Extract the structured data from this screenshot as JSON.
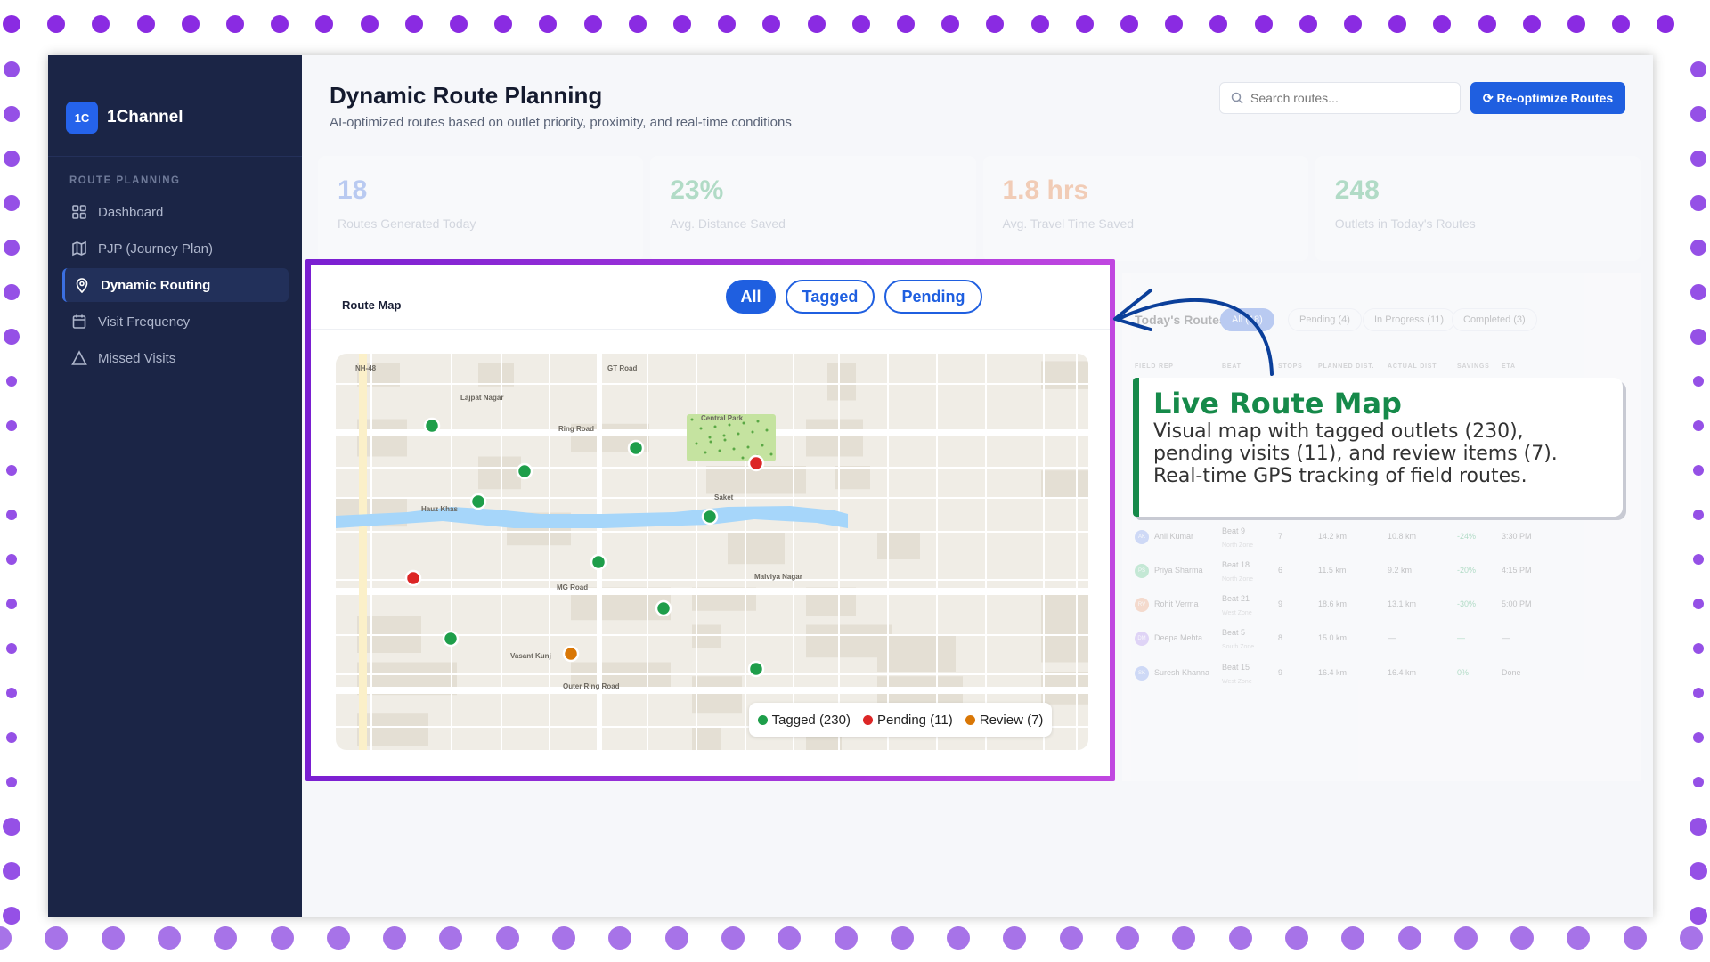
{
  "sidebar": {
    "logo": "1C",
    "brand": "1Channel",
    "section": "ROUTE PLANNING",
    "items": [
      {
        "label": "Dashboard",
        "icon": "grid-icon"
      },
      {
        "label": "PJP (Journey Plan)",
        "icon": "map-icon"
      },
      {
        "label": "Dynamic Routing",
        "icon": "location-pin-icon",
        "active": true
      },
      {
        "label": "Visit Frequency",
        "icon": "calendar-icon"
      },
      {
        "label": "Missed Visits",
        "icon": "warning-icon"
      }
    ]
  },
  "header": {
    "title": "Dynamic Route Planning",
    "subtitle": "AI-optimized routes based on outlet priority, proximity, and real-time conditions",
    "search_placeholder": "Search routes...",
    "reoptimize": "⟳ Re-optimize Routes"
  },
  "stats": [
    {
      "value": "18",
      "label": "Routes Generated Today",
      "color": "#3b6fe0"
    },
    {
      "value": "23%",
      "label": "Avg. Distance Saved",
      "color": "#22a35a"
    },
    {
      "value": "1.8 hrs",
      "label": "Avg. Travel Time Saved",
      "color": "#e8742a"
    },
    {
      "value": "248",
      "label": "Outlets in Today's Routes",
      "color": "#22a35a"
    }
  ],
  "map_card": {
    "title": "Route Map",
    "filters": [
      "All",
      "Tagged",
      "Pending"
    ],
    "active_filter": "All",
    "labels": [
      "NH-48",
      "Lajpat Nagar",
      "Ring Road",
      "GT Road",
      "Central Park",
      "Hauz Khas",
      "Saket",
      "Malviya Nagar",
      "MG Road",
      "Vasant Kunj",
      "Outer Ring Road"
    ],
    "legend": [
      {
        "label": "Tagged (230)",
        "color": "#1e9e4a"
      },
      {
        "label": "Pending (11)",
        "color": "#dc2626"
      },
      {
        "label": "Review (7)",
        "color": "#d97706"
      }
    ]
  },
  "routes": {
    "title": "Today's Routes",
    "tabs": [
      "All (18)",
      "Pending (4)",
      "In Progress (11)",
      "Completed (3)"
    ],
    "columns": [
      "FIELD REP",
      "BEAT",
      "STOPS",
      "PLANNED DIST.",
      "ACTUAL DIST.",
      "SAVINGS",
      "ETA"
    ],
    "rows": [
      {
        "initials": "SK",
        "name": "Suresh Khanna",
        "beat": "Beat 15",
        "zone": "West Zone",
        "stops": "9",
        "planned": "16.4 km",
        "actual": "16.4 km",
        "savings": "0%",
        "eta": "Done",
        "color": "#7c9cf0"
      },
      {
        "initials": "AK",
        "name": "Anil Kumar",
        "beat": "Beat 9",
        "zone": "North Zone",
        "stops": "7",
        "planned": "14.2 km",
        "actual": "10.8 km",
        "savings": "-24%",
        "eta": "3:30 PM",
        "color": "#7c9cf0"
      },
      {
        "initials": "PS",
        "name": "Priya Sharma",
        "beat": "Beat 18",
        "zone": "North Zone",
        "stops": "6",
        "planned": "11.5 km",
        "actual": "9.2 km",
        "savings": "-20%",
        "eta": "4:15 PM",
        "color": "#5cc98a"
      },
      {
        "initials": "RV",
        "name": "Rohit Verma",
        "beat": "Beat 21",
        "zone": "West Zone",
        "stops": "9",
        "planned": "18.6 km",
        "actual": "13.1 km",
        "savings": "-30%",
        "eta": "5:00 PM",
        "color": "#f0a070"
      },
      {
        "initials": "DM",
        "name": "Deepa Mehta",
        "beat": "Beat 5",
        "zone": "South Zone",
        "stops": "8",
        "planned": "15.0 km",
        "actual": "—",
        "savings": "—",
        "eta": "—",
        "color": "#b08cf0"
      },
      {
        "initials": "SK",
        "name": "Suresh Khanna",
        "beat": "Beat 15",
        "zone": "West Zone",
        "stops": "9",
        "planned": "16.4 km",
        "actual": "16.4 km",
        "savings": "0%",
        "eta": "Done",
        "color": "#7c9cf0"
      }
    ]
  },
  "callout": {
    "title": "Live Route Map",
    "body": "Visual map with tagged outlets (230), pending visits (11), and review items (7). Real-time GPS tracking of field routes.",
    "accent": "#168a4a"
  }
}
